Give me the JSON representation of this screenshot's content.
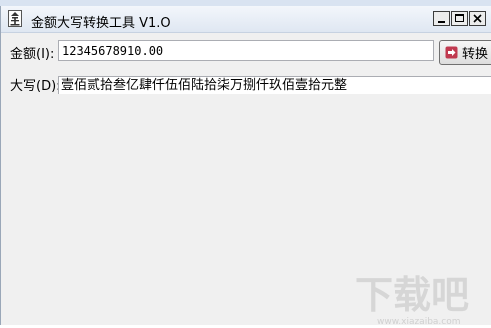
{
  "window": {
    "title": "金额大写转换工具 V1.O"
  },
  "amount": {
    "label": "金额",
    "hotkey": "(I)",
    "value": "12345678910.00"
  },
  "convert_button": {
    "label": "转换"
  },
  "upper": {
    "label": "大写",
    "hotkey": "(D)",
    "value": "壹佰贰拾叁亿肆仟伍佰陆拾柒万捌仟玖佰壹拾元整"
  },
  "watermark": {
    "text": "下载吧",
    "url": "www.xiazaiba.com"
  },
  "icons": [
    "app-icon",
    "minimize-icon",
    "maximize-icon",
    "close-icon",
    "convert-arrow-icon"
  ],
  "colors": {
    "titlebar": "#dfe7f2",
    "window_bg": "#f0f0f0",
    "convert_icon": "#b5344a"
  }
}
